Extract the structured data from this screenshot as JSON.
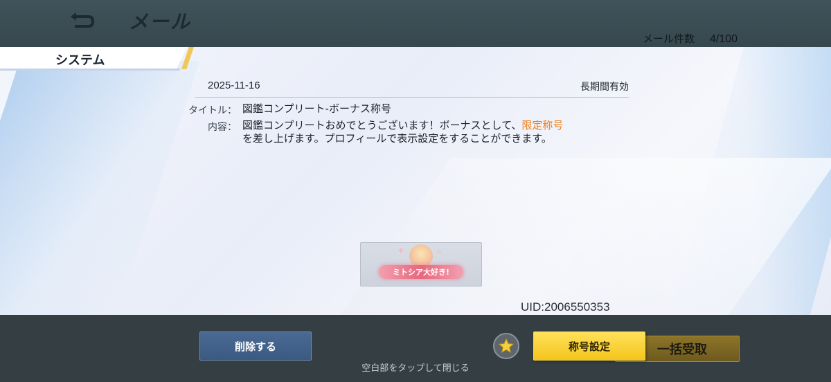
{
  "header": {
    "title": "メール",
    "back_icon": "back-arrow-icon",
    "mail_count_label": "メール件数",
    "mail_count_value": "4/100"
  },
  "tab": {
    "label": "システム"
  },
  "mail": {
    "date": "2025-11-16",
    "validity": "長期間有効",
    "title_label": "タイトル：",
    "title_value": "図鑑コンプリート-ボーナス称号",
    "content_label": "内容：",
    "content_part1": "図鑑コンプリートおめでとうございます！ボーナスとして、",
    "content_highlight": "限定称号",
    "content_part2": "を差し上げます。プロフィールで表示設定をすることができます。",
    "reward_banner_text": "ミトシア大好き!",
    "uid": "UID:2006550353"
  },
  "footer": {
    "delete_label": "削除する",
    "star_icon": "star-icon",
    "title_setting_label": "称号設定",
    "claim_all_label": "一括受取",
    "tap_close_hint": "空白部をタップして閉じる"
  },
  "colors": {
    "highlight": "#ee7d1a",
    "primary_button": "#f5c51d",
    "delete_button": "#3b5a82"
  }
}
